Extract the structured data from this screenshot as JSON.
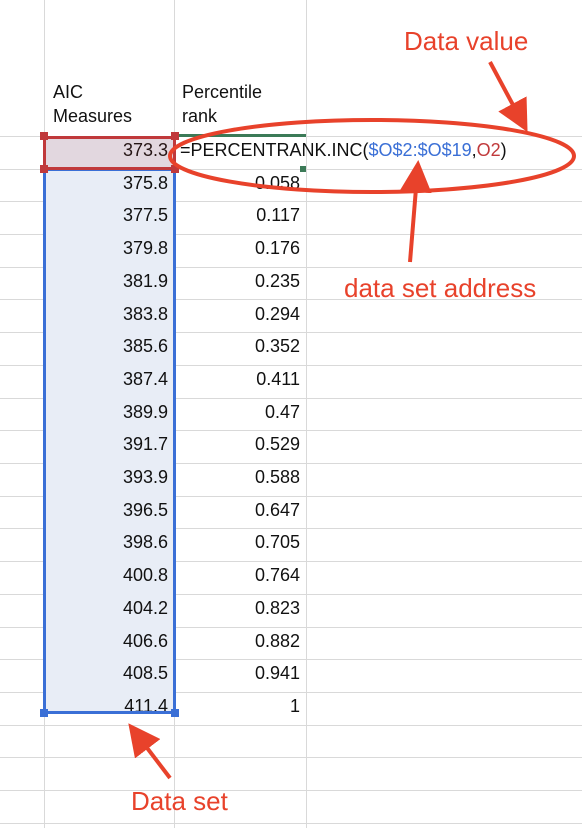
{
  "headers": {
    "col_o_line1": "AIC",
    "col_o_line2": "Measures",
    "col_p_line1": "Percentile",
    "col_p_line2": "rank"
  },
  "aic_measures": [
    "373.3",
    "375.8",
    "377.5",
    "379.8",
    "381.9",
    "383.8",
    "385.6",
    "387.4",
    "389.9",
    "391.7",
    "393.9",
    "396.5",
    "398.6",
    "400.8",
    "404.2",
    "406.6",
    "408.5",
    "411.4"
  ],
  "percentile_ranks": [
    "0.058",
    "0.117",
    "0.176",
    "0.235",
    "0.294",
    "0.352",
    "0.411",
    "0.47",
    "0.529",
    "0.588",
    "0.647",
    "0.705",
    "0.764",
    "0.823",
    "0.882",
    "0.941",
    "1"
  ],
  "formula": {
    "prefix": "=PERCENTRANK.INC(",
    "range_ref": "$O$2:$O$19",
    "separator": ",",
    "value_ref": "O2",
    "suffix": ")"
  },
  "annotations": {
    "data_value": "Data value",
    "data_set_address": "data set address",
    "data_set": "Data set"
  },
  "colors": {
    "annotation": "#e8422b",
    "range_blue": "#3a6fd6",
    "value_red": "#c0393b",
    "active_green": "#3b7a57",
    "grid": "#d9d9d9"
  }
}
